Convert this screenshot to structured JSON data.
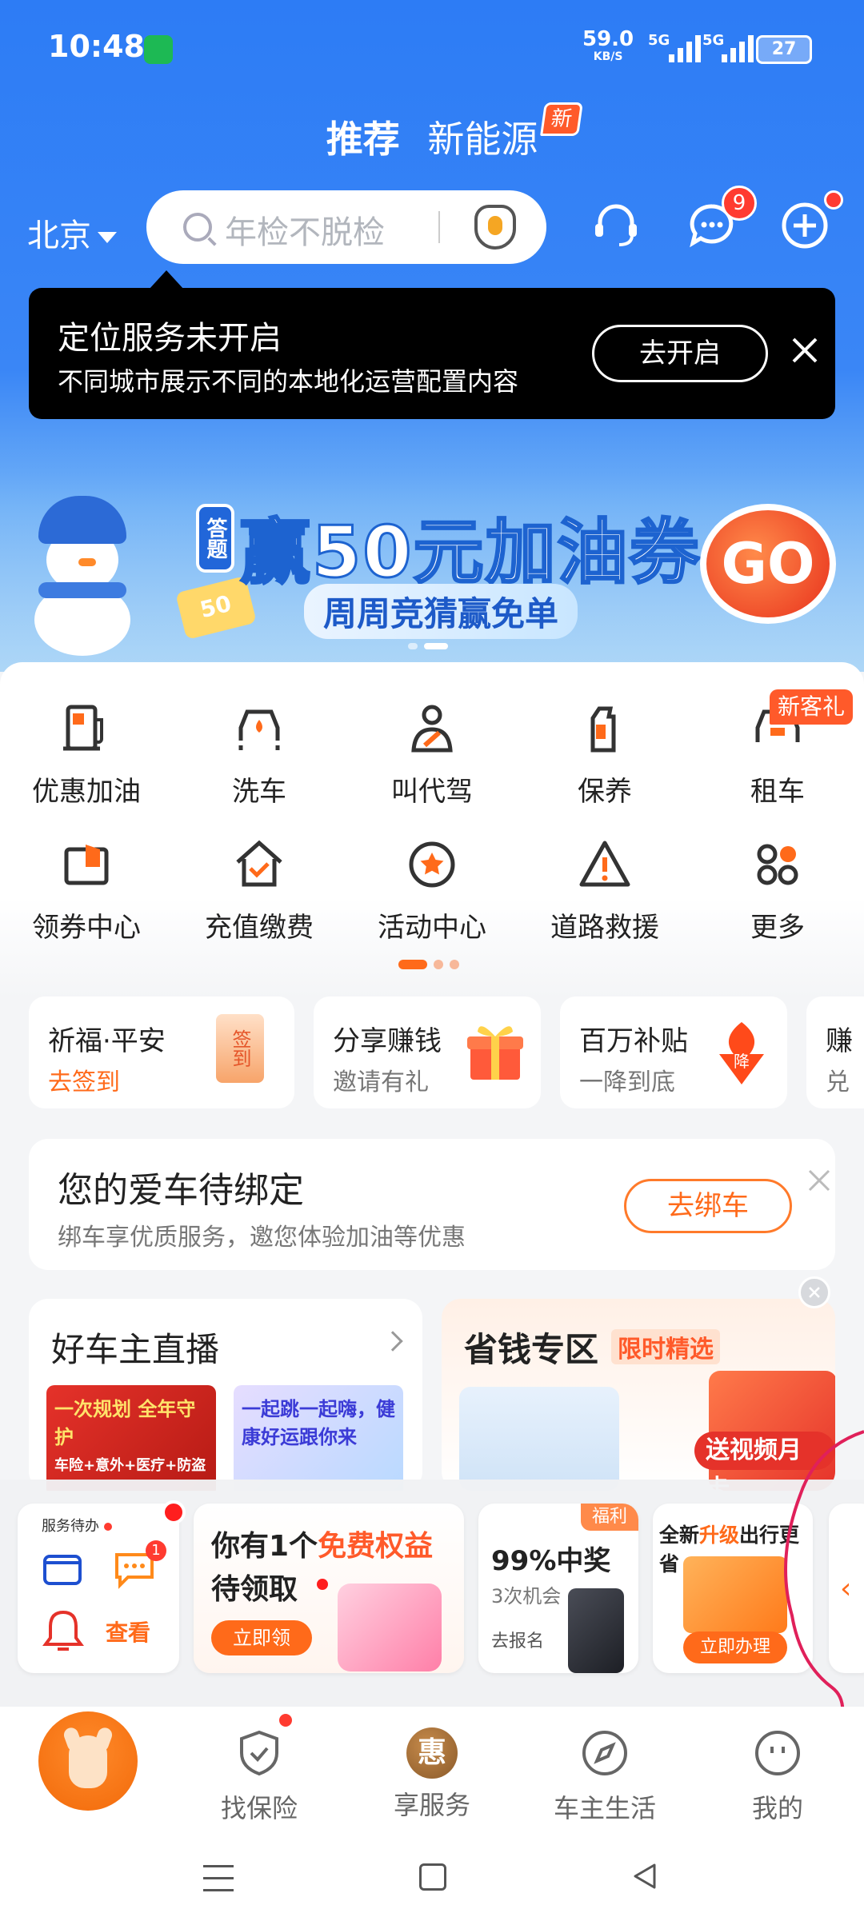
{
  "status_bar": {
    "time": "10:48",
    "net_speed": "59.0",
    "net_unit": "KB/S",
    "sim1": "5G",
    "sim2": "5G",
    "battery": "27"
  },
  "top_tabs": [
    {
      "label": "推荐",
      "active": true
    },
    {
      "label": "新能源",
      "badge": "新"
    }
  ],
  "header": {
    "city": "北京",
    "search_placeholder": "年检不脱检",
    "message_badge": "9"
  },
  "location_tip": {
    "title": "定位服务未开启",
    "desc": "不同城市展示不同的本地化运营配置内容",
    "button": "去开启"
  },
  "banner": {
    "tag": "答题",
    "headline": "赢50元加油券",
    "subline": "周周竞猜赢免单",
    "go": "GO",
    "coupon": "50"
  },
  "services": [
    {
      "label": "优惠加油",
      "icon": "fuel-pump-icon"
    },
    {
      "label": "洗车",
      "icon": "car-wash-icon"
    },
    {
      "label": "叫代驾",
      "icon": "driver-icon"
    },
    {
      "label": "保养",
      "icon": "oil-bottle-icon"
    },
    {
      "label": "租车",
      "icon": "rental-car-icon",
      "badge": "新客礼"
    },
    {
      "label": "领券中心",
      "icon": "wallet-icon"
    },
    {
      "label": "充值缴费",
      "icon": "house-check-icon"
    },
    {
      "label": "活动中心",
      "icon": "star-circle-icon"
    },
    {
      "label": "道路救援",
      "icon": "warning-triangle-icon"
    },
    {
      "label": "更多",
      "icon": "more-grid-icon"
    }
  ],
  "quick_cards": [
    {
      "title": "祈福·平安",
      "sub": "去签到",
      "sub_highlight": true,
      "art": "签到"
    },
    {
      "title": "分享赚钱",
      "sub": "邀请有礼"
    },
    {
      "title": "百万补贴",
      "sub": "一降到底",
      "art": "降"
    },
    {
      "title": "赚",
      "sub": "兑"
    }
  ],
  "bind_car": {
    "title": "您的爱车待绑定",
    "desc": "绑车享优质服务，邀您体验加油等优惠",
    "button": "去绑车"
  },
  "live": {
    "title": "好车主直播",
    "thumb1": "一次规划 全年守护",
    "thumb1_sub": "车险+意外+医疗+防盗",
    "thumb2": "一起跳一起嗨，健康好运跟你来"
  },
  "saving": {
    "title": "省钱专区",
    "tag": "限时精选",
    "promo": "送视频月卡"
  },
  "float_cards": {
    "todo_header": "服务待办",
    "todo_badge": "1",
    "todo_action": "查看",
    "benefit_line1_a": "你有1个",
    "benefit_line1_b": "免费权益",
    "benefit_line2": "待领取",
    "benefit_button": "立即领",
    "lottery_tag": "福利",
    "lottery_title": "99%中奖",
    "lottery_sub": "3次机会",
    "lottery_action": "去报名",
    "card_title_a": "全新",
    "card_title_b": "升级",
    "card_title_c": "出行更省",
    "card_button": "立即办理"
  },
  "bottom_nav": [
    {
      "label": "找保险",
      "icon": "shield-check-icon",
      "dot": true
    },
    {
      "label": "享服务",
      "icon": "hui-icon",
      "glyph": "惠"
    },
    {
      "label": "车主生活",
      "icon": "compass-icon"
    },
    {
      "label": "我的",
      "icon": "smiley-icon"
    }
  ],
  "colors": {
    "brand_blue": "#2d7cf5",
    "accent_orange": "#ff6a1a",
    "alert_red": "#ff3b30"
  }
}
